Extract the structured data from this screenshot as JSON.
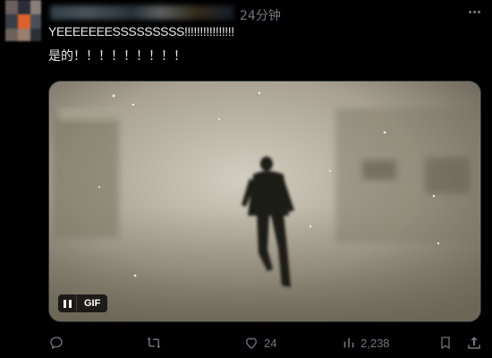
{
  "post": {
    "time": "24分钟",
    "text_line1": "YEEEEEEESSSSSSSSS!!!!!!!!!!!!!!!!",
    "text_line2": "是的！！！！！！！！！"
  },
  "media": {
    "badge_label": "GIF",
    "pause_icon": "pause-icon"
  },
  "actions": {
    "reply_icon": "reply-icon",
    "retweet_icon": "retweet-icon",
    "like_icon": "heart-icon",
    "likes": "24",
    "views_icon": "views-icon",
    "views": "2,238",
    "bookmark_icon": "bookmark-icon",
    "share_icon": "share-icon"
  },
  "colors": {
    "background": "#000000",
    "text": "#e7e9ea",
    "muted": "#71767b"
  }
}
